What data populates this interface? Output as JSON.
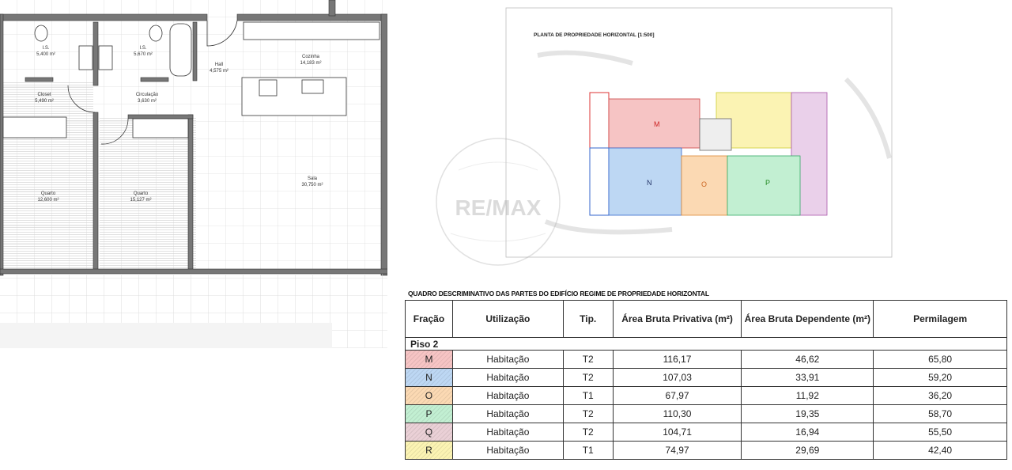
{
  "floor_plan": {
    "rooms": [
      {
        "name": "I.S.",
        "area": "5,400 m²"
      },
      {
        "name": "I.S.",
        "area": "5,670 m²"
      },
      {
        "name": "Hall",
        "area": "4,575 m²"
      },
      {
        "name": "Cozinha",
        "area": "14,183 m²"
      },
      {
        "name": "Closet",
        "area": "5,490 m²"
      },
      {
        "name": "Circulação",
        "area": "3,630 m²"
      },
      {
        "name": "Sala",
        "area": "30,750 m²"
      },
      {
        "name": "Quarto",
        "area": "12,600 m²"
      },
      {
        "name": "Quarto",
        "area": "15,127 m²"
      }
    ]
  },
  "site_plan": {
    "title": "PLANTA DE PROPRIEDADE HORIZONTAL [1:500]",
    "labels": [
      "M",
      "N",
      "O",
      "P"
    ],
    "watermark": "RE/MAX"
  },
  "table": {
    "title": "QUADRO DESCRIMINATIVO DAS PARTES DO EDIFÍCIO REGIME DE PROPRIEDADE HORIZONTAL",
    "headers": [
      "Fração",
      "Utilização",
      "Tip.",
      "Área Bruta Privativa (m²)",
      "Área Bruta Dependente (m²)",
      "Permilagem"
    ],
    "section": "Piso 2",
    "rows": [
      {
        "fracao": "M",
        "utilizacao": "Habitação",
        "tip": "T2",
        "privativa": "116,17",
        "dependente": "46,62",
        "permilagem": "65,80",
        "color": "#f6c4c4"
      },
      {
        "fracao": "N",
        "utilizacao": "Habitação",
        "tip": "T2",
        "privativa": "107,03",
        "dependente": "33,91",
        "permilagem": "59,20",
        "color": "#bdd7f3"
      },
      {
        "fracao": "O",
        "utilizacao": "Habitação",
        "tip": "T1",
        "privativa": "67,97",
        "dependente": "11,92",
        "permilagem": "36,20",
        "color": "#fbd9b3"
      },
      {
        "fracao": "P",
        "utilizacao": "Habitação",
        "tip": "T2",
        "privativa": "110,30",
        "dependente": "19,35",
        "permilagem": "58,70",
        "color": "#c2efd2"
      },
      {
        "fracao": "Q",
        "utilizacao": "Habitação",
        "tip": "T2",
        "privativa": "104,71",
        "dependente": "16,94",
        "permilagem": "55,50",
        "color": "#ead0d6"
      },
      {
        "fracao": "R",
        "utilizacao": "Habitação",
        "tip": "T1",
        "privativa": "74,97",
        "dependente": "29,69",
        "permilagem": "42,40",
        "color": "#fbf3b3"
      }
    ]
  }
}
